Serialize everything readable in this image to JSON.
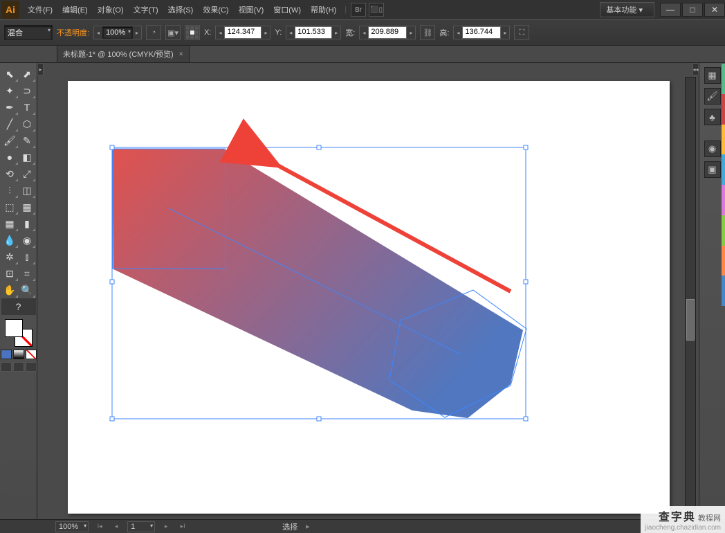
{
  "app": {
    "logo": "Ai",
    "workspace_label": "基本功能"
  },
  "menus": [
    "文件(F)",
    "编辑(E)",
    "对象(O)",
    "文字(T)",
    "选择(S)",
    "效果(C)",
    "视图(V)",
    "窗口(W)",
    "帮助(H)"
  ],
  "toolbar_icons": [
    "Br",
    "⬛▯"
  ],
  "window_buttons": {
    "min": "—",
    "max": "□",
    "close": "✕"
  },
  "control": {
    "mode_label": "混合",
    "opacity_label": "不透明度:",
    "opacity_value": "100%",
    "x_label": "X:",
    "x_value": "124.347",
    "y_label": "Y:",
    "y_value": "101.533",
    "w_label": "宽:",
    "w_value": "209.889",
    "h_label": "高:",
    "h_value": "136.744"
  },
  "tab": {
    "title": "未标题-1* @ 100% (CMYK/预览)",
    "close": "×"
  },
  "tools": [
    [
      "selection-tool",
      "direct-selection-tool"
    ],
    [
      "magic-wand-tool",
      "lasso-tool"
    ],
    [
      "pen-tool",
      "type-tool"
    ],
    [
      "line-tool",
      "rectangle-tool"
    ],
    [
      "paintbrush-tool",
      "pencil-tool"
    ],
    [
      "blob-brush-tool",
      "eraser-tool"
    ],
    [
      "rotate-tool",
      "scale-tool"
    ],
    [
      "width-tool",
      "free-transform-tool"
    ],
    [
      "shape-builder-tool",
      "perspective-grid-tool"
    ],
    [
      "mesh-tool",
      "gradient-tool"
    ],
    [
      "eyedropper-tool",
      "blend-tool"
    ],
    [
      "symbol-sprayer-tool",
      "column-graph-tool"
    ],
    [
      "artboard-tool",
      "slice-tool"
    ],
    [
      "hand-tool",
      "zoom-tool"
    ]
  ],
  "tool_glyphs": [
    [
      "⬉",
      "⬈"
    ],
    [
      "✦",
      "⊃"
    ],
    [
      "✒",
      "T"
    ],
    [
      "╱",
      "⬡"
    ],
    [
      "🖌",
      "✎"
    ],
    [
      "●",
      "◧"
    ],
    [
      "⟲",
      "⤢"
    ],
    [
      "⫶",
      "◫"
    ],
    [
      "⬚",
      "▦"
    ],
    [
      "▦",
      "▮"
    ],
    [
      "💧",
      "◉"
    ],
    [
      "✲",
      "⫾"
    ],
    [
      "⊡",
      "⌗"
    ],
    [
      "✋",
      "🔍"
    ]
  ],
  "tool_help": "?",
  "rightpanel": [
    "▦",
    "🖌",
    "♣",
    "",
    "◉",
    "▣"
  ],
  "status": {
    "zoom": "100%",
    "page": "1",
    "selection_label": "选择"
  },
  "watermark": {
    "brand": "查字典",
    "sub": "教程网",
    "url": "jiaocheng.chazidian.com"
  }
}
